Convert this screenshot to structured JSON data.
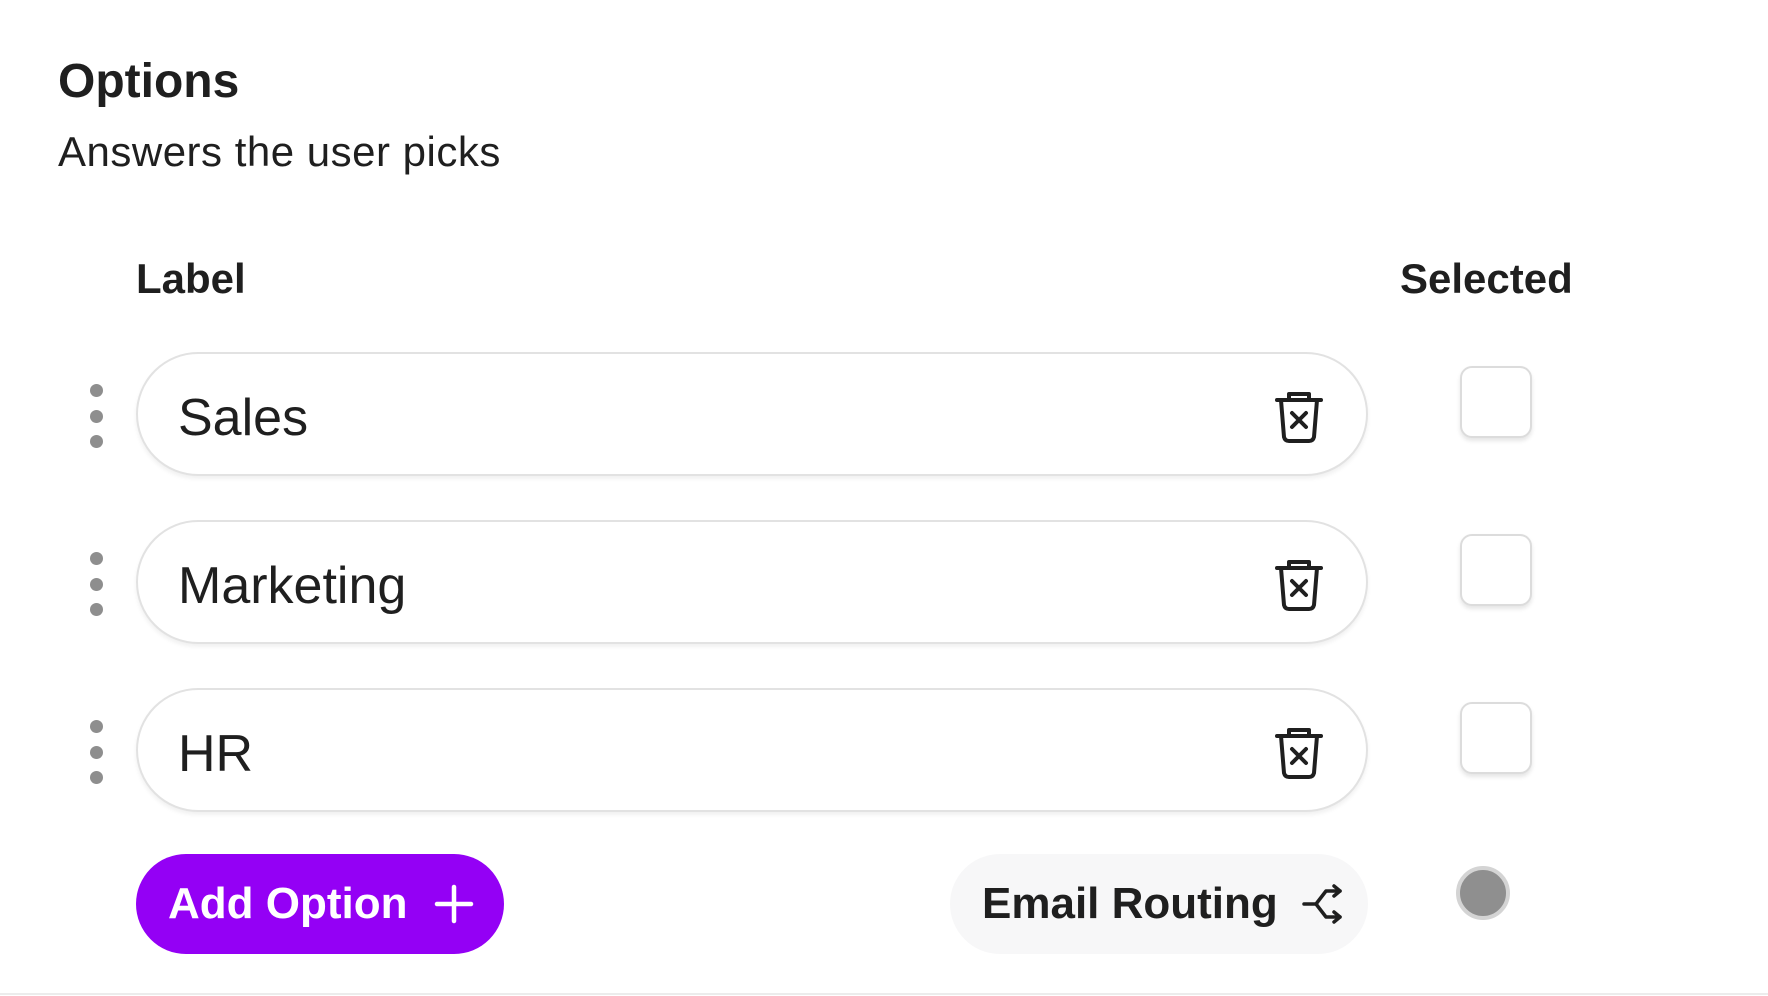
{
  "section": {
    "title": "Options",
    "subtitle": "Answers the user picks"
  },
  "columns": {
    "label": "Label",
    "selected": "Selected"
  },
  "options": [
    {
      "label": "Sales",
      "selected": false
    },
    {
      "label": "Marketing",
      "selected": false
    },
    {
      "label": "HR",
      "selected": false
    }
  ],
  "actions": {
    "add_option_label": "Add Option",
    "email_routing_label": "Email Routing"
  },
  "icons": {
    "drag": "drag-handle-icon",
    "delete": "trash-x-icon",
    "add": "plus-icon",
    "routing": "route-split-icon"
  },
  "colors": {
    "accent": "#9400f5",
    "routing_bg": "#f7f7f8",
    "status_dot": "#8f8f8f"
  }
}
